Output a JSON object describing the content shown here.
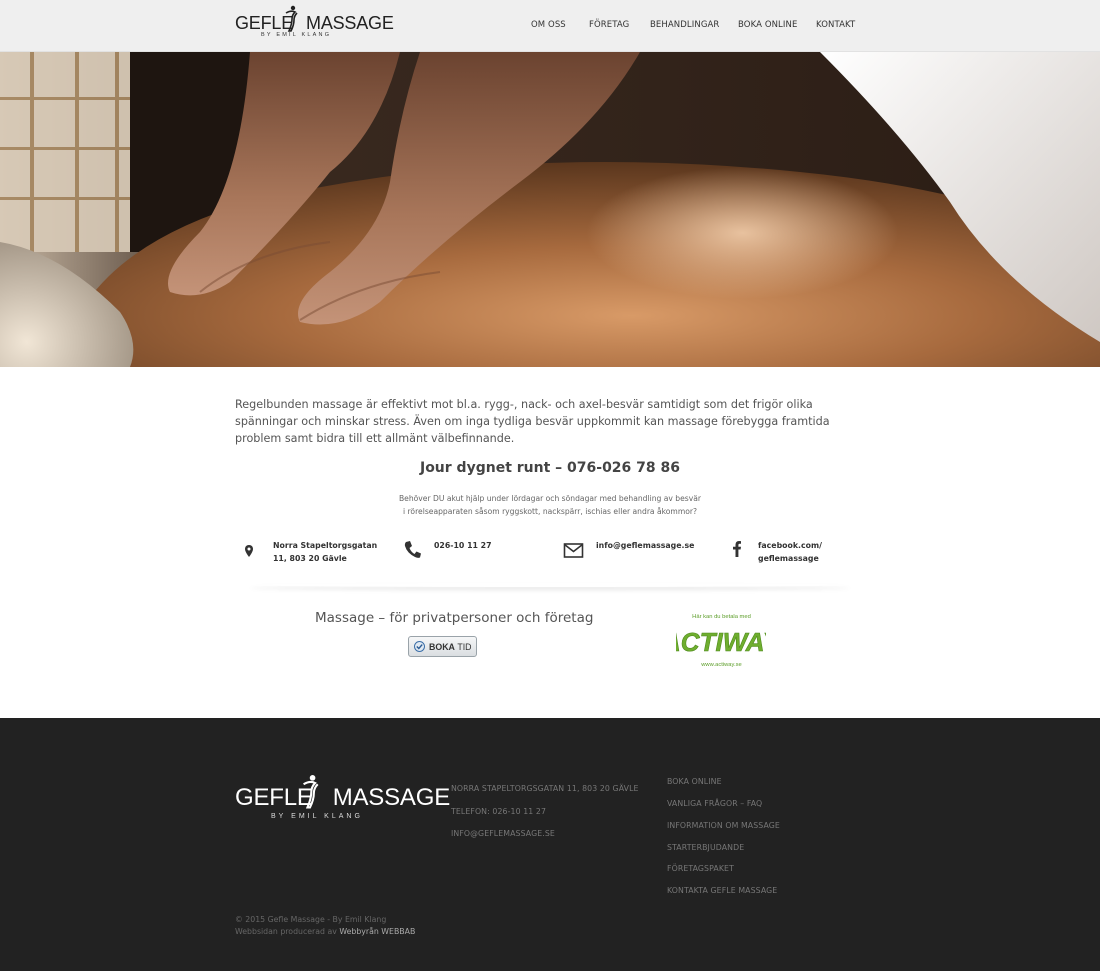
{
  "header": {
    "logo_text": "GEFLE MASSAGE",
    "logo_left": "GEFLE",
    "logo_right": "MASSAGE",
    "logo_sub": "BY EMIL KLANG",
    "nav": [
      "OM OSS",
      "FÖRETAG",
      "BEHANDLINGAR",
      "BOKA ONLINE",
      "KONTAKT"
    ]
  },
  "intro": {
    "text": "Regelbunden massage är effektivt mot bl.a. rygg-, nack- och axel-besvär samtidigt som det frigör olika spänningar och minskar stress. Även om inga tydliga besvär uppkommit kan massage förebygga framtida problem samt bidra till ett allmänt välbefinnande."
  },
  "hotline": {
    "title": "Jour dygnet runt – 076-026 78 86",
    "line1": "Behöver DU akut hjälp under lördagar och söndagar med behandling av besvär",
    "line2": "i rörelseapparaten såsom ryggskott, nackspärr, ischias eller andra åkommor?"
  },
  "contacts": {
    "address_line1": "Norra Stapeltorgsgatan",
    "address_line2": "11, 803 20 Gävle",
    "phone": "026-10 11 27",
    "email": "info@geflemassage.se",
    "facebook_line1": "facebook.com/",
    "facebook_line2": "geflemassage",
    "icons": [
      "map-marker-icon",
      "phone-icon",
      "envelope-icon",
      "facebook-icon"
    ]
  },
  "booking": {
    "title": "Massage – för privatpersoner och företag",
    "button_bold": "BOKA",
    "button_rest": "TID"
  },
  "actiway": {
    "top": "Här kan du betala med",
    "logo": "ACTIWAY",
    "url": "www.actiway.se"
  },
  "footer": {
    "logo_left": "GEFLE",
    "logo_right": "MASSAGE",
    "logo_sub": "BY EMIL KLANG",
    "address": "NORRA STAPELTORGSGATAN 11, 803 20 GÄVLE",
    "phone": "TELEFON: 026-10 11 27",
    "email": "INFO@GEFLEMASSAGE.SE",
    "links": [
      "BOKA ONLINE",
      "VANLIGA FRÅGOR – FAQ",
      "INFORMATION OM MASSAGE",
      "STARTERBJUDANDE",
      "FÖRETAGSPAKET",
      "KONTAKTA GEFLE MASSAGE"
    ],
    "copyright": "© 2015 Gefle Massage - By Emil Klang",
    "produced_prefix": "Webbsidan producerad av",
    "produced_link": "Webbyrån WEBBAB"
  },
  "colors": {
    "header_bg": "#efefef",
    "footer_bg": "#222222",
    "actiway_green": "#6fae2f"
  }
}
